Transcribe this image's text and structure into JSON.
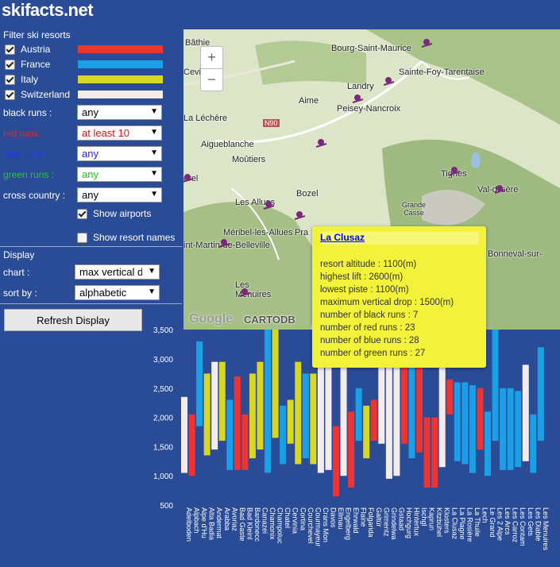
{
  "site": {
    "title": "skifacts.net"
  },
  "filters": {
    "heading": "Filter ski resorts",
    "countries": [
      {
        "label": "Austria",
        "checked": true,
        "color": "#ee3333"
      },
      {
        "label": "France",
        "checked": true,
        "color": "#1aa0e6"
      },
      {
        "label": "Italy",
        "checked": true,
        "color": "#d7d724"
      },
      {
        "label": "Switzerland",
        "checked": true,
        "color": "#f4ecea"
      }
    ],
    "runs": [
      {
        "label": "black runs :",
        "value": "any",
        "label_color": "#ffffff",
        "value_color": "#000000"
      },
      {
        "label": "red runs :",
        "value": "at least 10",
        "label_color": "#ee2222",
        "value_color": "#dd1111"
      },
      {
        "label": "blue runs :",
        "value": "any",
        "label_color": "#2222ff",
        "value_color": "#2222ff"
      },
      {
        "label": "green runs :",
        "value": "any",
        "label_color": "#22cc22",
        "value_color": "#22cc22"
      },
      {
        "label": "cross country :",
        "value": "any",
        "label_color": "#ffffff",
        "value_color": "#000000"
      }
    ],
    "show_airports": {
      "label": "Show airports",
      "checked": true
    },
    "show_resort_names": {
      "label": "Show resort names",
      "checked": false
    }
  },
  "display": {
    "heading": "Display",
    "chart_label": "chart :",
    "chart_value": "max vertical d",
    "sort_label": "sort by :",
    "sort_value": "alphabetic",
    "refresh_label": "Refresh Display"
  },
  "map": {
    "zoom_in": "+",
    "zoom_out": "−",
    "attribution": [
      "Google",
      "CARTODB"
    ],
    "labels": [
      "Bâthie",
      "Bourg-Saint-Maurice",
      "Sainte-Foy-Tarentaise",
      "Landry",
      "Aime",
      "Peisey-Nancroix",
      "Cevi",
      "La Léchère",
      "N90",
      "Aigueblanche",
      "Moûtiers",
      "Tignes",
      "Val-d'Isère",
      "orel",
      "Bozel",
      "Grande Casse",
      "Les Allues",
      "Méribel-les-Allues",
      "int-Martin-de-Belleville",
      "Pra",
      "Bonneval-sur-",
      "Les Menuires"
    ]
  },
  "popup": {
    "title": "La Clusaz",
    "lines": [
      "resort altitude : 1100(m)",
      "highest lift : 2600(m)",
      "lowest piste : 1100(m)",
      "maximum vertical drop : 1500(m)",
      "number of black runs : 7",
      "number of red runs : 23",
      "number of blue runs : 28",
      "number of green runs : 27"
    ]
  },
  "chart_data": {
    "type": "bar",
    "subtype": "floating-range",
    "y_ticks": [
      "500",
      "1,000",
      "1,500",
      "2,000",
      "2,500",
      "3,000",
      "3,500"
    ],
    "ylim": [
      500,
      3600
    ],
    "country_colors": {
      "Austria": "#ee3333",
      "France": "#1aa0e6",
      "Italy": "#d7d724",
      "Switzerland": "#f4ecea"
    },
    "bars": [
      {
        "label": "Adelboden",
        "country": "Switzerland",
        "low": 1050,
        "high": 2350
      },
      {
        "label": "Alpbach",
        "country": "Austria",
        "low": 1000,
        "high": 2050
      },
      {
        "label": "Alpe d'Hu",
        "country": "France",
        "low": 1850,
        "high": 3300
      },
      {
        "label": "Alta Badia",
        "country": "Italy",
        "low": 1350,
        "high": 2750
      },
      {
        "label": "Andermat",
        "country": "Switzerland",
        "low": 1450,
        "high": 2950
      },
      {
        "label": "Arabba",
        "country": "Italy",
        "low": 1600,
        "high": 2950
      },
      {
        "label": "Avoriaz",
        "country": "France",
        "low": 1100,
        "high": 2300
      },
      {
        "label": "Bad Gaste",
        "country": "Austria",
        "low": 1100,
        "high": 2700
      },
      {
        "label": "Bad Kleinl",
        "country": "Austria",
        "low": 1100,
        "high": 2050
      },
      {
        "label": "Bardonecc",
        "country": "Italy",
        "low": 1300,
        "high": 2750
      },
      {
        "label": "Canazei",
        "country": "Italy",
        "low": 1450,
        "high": 2950
      },
      {
        "label": "Chamonix",
        "country": "France",
        "low": 1050,
        "high": 3600
      },
      {
        "label": "Champoluc",
        "country": "Italy",
        "low": 1650,
        "high": 3550
      },
      {
        "label": "Chatel",
        "country": "France",
        "low": 1200,
        "high": 2200
      },
      {
        "label": "Cervinia",
        "country": "Italy",
        "low": 1550,
        "high": 2300
      },
      {
        "label": "Cortina",
        "country": "Italy",
        "low": 1200,
        "high": 2950
      },
      {
        "label": "Courchevel",
        "country": "France",
        "low": 1300,
        "high": 2750
      },
      {
        "label": "Courmayeur",
        "country": "Italy",
        "low": 1200,
        "high": 2750
      },
      {
        "label": "Crans Mon",
        "country": "Switzerland",
        "low": 1050,
        "high": 3000
      },
      {
        "label": "Davos",
        "country": "Switzerland",
        "low": 1100,
        "high": 2850
      },
      {
        "label": "Ellmau",
        "country": "Austria",
        "low": 650,
        "high": 1850
      },
      {
        "label": "Engelberg",
        "country": "Switzerland",
        "low": 1000,
        "high": 3000
      },
      {
        "label": "Ehrwald",
        "country": "Austria",
        "low": 800,
        "high": 2100
      },
      {
        "label": "Flaine",
        "country": "France",
        "low": 1600,
        "high": 2500
      },
      {
        "label": "Folgarida",
        "country": "Italy",
        "low": 1300,
        "high": 2200
      },
      {
        "label": "Galtür",
        "country": "Austria",
        "low": 1600,
        "high": 2300
      },
      {
        "label": "Grimentz",
        "country": "Switzerland",
        "low": 1550,
        "high": 2900
      },
      {
        "label": "Grindelwa",
        "country": "Switzerland",
        "low": 950,
        "high": 3000
      },
      {
        "label": "Gstaad",
        "country": "Switzerland",
        "low": 1000,
        "high": 3000
      },
      {
        "label": "Hochgurg",
        "country": "Austria",
        "low": 1550,
        "high": 3050
      },
      {
        "label": "Hintertux",
        "country": "France",
        "low": 1300,
        "high": 3250
      },
      {
        "label": "Ischgl",
        "country": "Austria",
        "low": 1400,
        "high": 2900
      },
      {
        "label": "Kaprun",
        "country": "Austria",
        "low": 800,
        "high": 2000
      },
      {
        "label": "Kitzbühel",
        "country": "Austria",
        "low": 800,
        "high": 2000
      },
      {
        "label": "Klosters",
        "country": "Switzerland",
        "low": 1150,
        "high": 2850
      },
      {
        "label": "La Clusaz",
        "country": "Austria",
        "low": 2050,
        "high": 2650
      },
      {
        "label": "La Plagne",
        "country": "France",
        "low": 1250,
        "high": 2600
      },
      {
        "label": "La Rosière",
        "country": "France",
        "low": 1200,
        "high": 2600
      },
      {
        "label": "La Thuile",
        "country": "France",
        "low": 1050,
        "high": 2550
      },
      {
        "label": "Lech",
        "country": "Austria",
        "low": 1450,
        "high": 2500
      },
      {
        "label": "Le Grand",
        "country": "France",
        "low": 1000,
        "high": 2100
      },
      {
        "label": "Les 2 Alpe",
        "country": "France",
        "low": 1600,
        "high": 3600
      },
      {
        "label": "Les Arcs",
        "country": "France",
        "low": 1100,
        "high": 2500
      },
      {
        "label": "Les Carroz",
        "country": "France",
        "low": 1100,
        "high": 2500
      },
      {
        "label": "Les Contam",
        "country": "France",
        "low": 1150,
        "high": 2450
      },
      {
        "label": "Les Gets",
        "country": "Switzerland",
        "low": 1250,
        "high": 2900
      },
      {
        "label": "Les Diable",
        "country": "France",
        "low": 1050,
        "high": 2050
      },
      {
        "label": "Les Menuires",
        "country": "France",
        "low": 1600,
        "high": 3200
      }
    ]
  }
}
